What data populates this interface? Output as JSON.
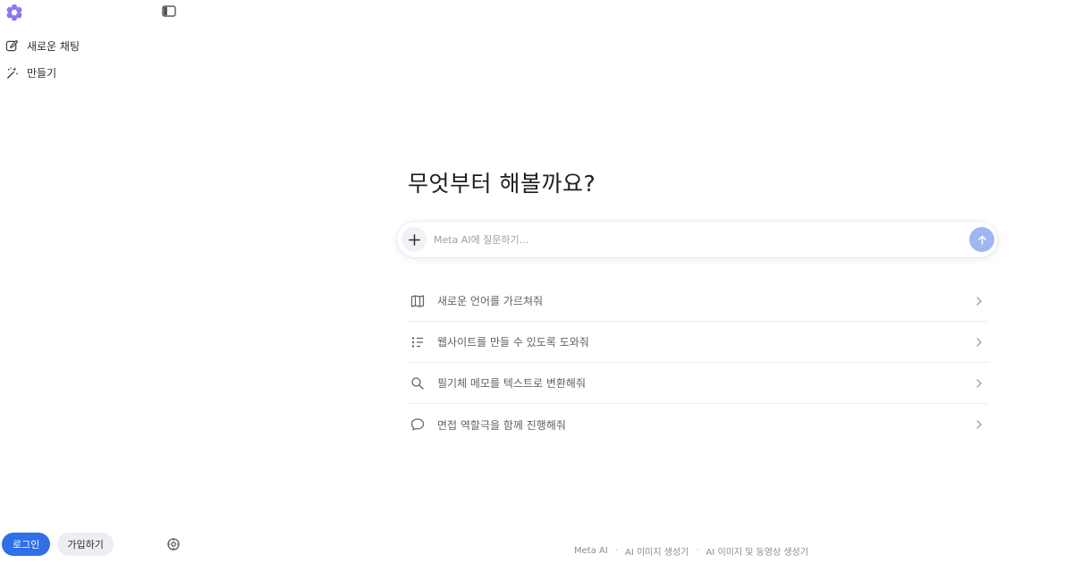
{
  "sidebar": {
    "logo_icon": "meta-ai-flower-icon",
    "collapse_icon": "sidebar-toggle-icon",
    "items": [
      {
        "label": "새로운 채팅",
        "icon": "edit-icon"
      },
      {
        "label": "만들기",
        "icon": "magic-wand-icon"
      }
    ],
    "login_label": "로그인",
    "signup_label": "가입하기",
    "settings_icon": "settings-icon"
  },
  "main": {
    "headline": "무엇부터 해볼까요?",
    "composer": {
      "placeholder": "Meta AI에 질문하기...",
      "plus_icon": "plus-icon",
      "send_icon": "arrow-up-icon"
    },
    "suggestions": [
      {
        "label": "새로운 언어를 가르쳐줘",
        "icon": "book-icon"
      },
      {
        "label": "웹사이트를 만들 수 있도록 도와줘",
        "icon": "checklist-icon"
      },
      {
        "label": "필기체 메모를 텍스트로 변환해줘",
        "icon": "search-icon"
      },
      {
        "label": "면접 역할극을 함께 진행해줘",
        "icon": "chat-bubble-icon"
      }
    ]
  },
  "footer": {
    "links": [
      "Meta AI",
      "AI 이미지 생성기",
      "AI 이미지 및 동영상 생성기"
    ]
  },
  "colors": {
    "accent": "#2f6fe8",
    "send_disabled": "#9fb7f0",
    "logo_gradient_start": "#a56cf0",
    "logo_gradient_end": "#5b7cf5"
  }
}
